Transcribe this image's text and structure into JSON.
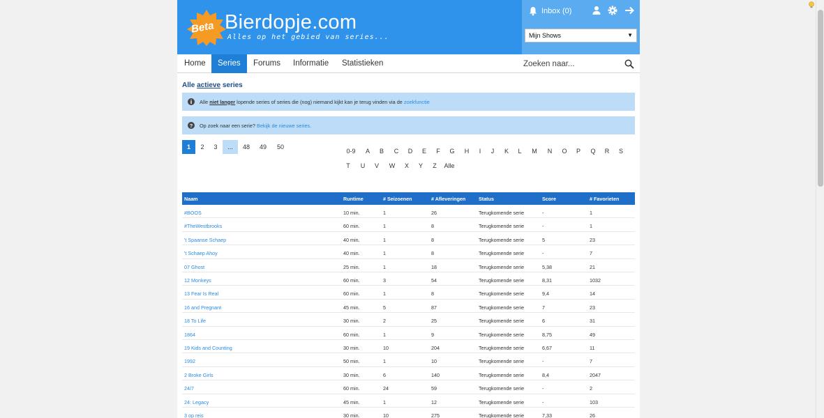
{
  "header": {
    "badge": "Beta",
    "logo_name": "Bierdopje.com",
    "tagline": "Alles op het gebied van series...",
    "inbox_label": "Inbox (0)",
    "shows_select": "Mijn Shows"
  },
  "nav": {
    "items": [
      "Home",
      "Series",
      "Forums",
      "Informatie",
      "Statistieken"
    ],
    "active": "Series",
    "search_placeholder": "Zoeken naar..."
  },
  "title": {
    "prefix": "Alle",
    "highlight": "actieve",
    "suffix": "series"
  },
  "alerts": {
    "first": {
      "t1": "Alle",
      "t2": "niet langer",
      "t3": "lopende series of series die (nog) niemand kijkt kan je terug vinden via de",
      "link": "zoekfunctie"
    },
    "second": {
      "t1": "Op zoek naar een serie?",
      "link": "Bekijk de nieuwe series."
    }
  },
  "pagination": [
    "1",
    "2",
    "3",
    "...",
    "48",
    "49",
    "50"
  ],
  "letters_row1": [
    "0-9",
    "A",
    "B",
    "C",
    "D",
    "E",
    "F",
    "G",
    "H",
    "I",
    "J",
    "K",
    "L",
    "M",
    "N",
    "O",
    "P",
    "Q",
    "R",
    "S"
  ],
  "letters_row2": [
    "T",
    "U",
    "V",
    "W",
    "X",
    "Y",
    "Z",
    "Alle"
  ],
  "table": {
    "columns": [
      "Naam",
      "Runtime",
      "# Seizoenen",
      "# Afleveringen",
      "Status",
      "Score",
      "# Favorieten"
    ],
    "rows": [
      [
        "#BOOS",
        "10 min.",
        "1",
        "26",
        "Terugkomende serie",
        "-",
        "1"
      ],
      [
        "#TheWestbrooks",
        "60 min.",
        "1",
        "8",
        "Terugkomende serie",
        "-",
        "1"
      ],
      [
        "'t Spaanse Schaep",
        "40 min.",
        "1",
        "8",
        "Terugkomende serie",
        "5",
        "23"
      ],
      [
        "'t Schaep Ahoy",
        "40 min.",
        "1",
        "8",
        "Terugkomende serie",
        "-",
        "7"
      ],
      [
        "07 Ghost",
        "25 min.",
        "1",
        "18",
        "Terugkomende serie",
        "5,38",
        "21"
      ],
      [
        "12 Monkeys",
        "60 min.",
        "3",
        "54",
        "Terugkomende serie",
        "8,31",
        "1032"
      ],
      [
        "13 Fear Is Real",
        "60 min.",
        "1",
        "8",
        "Terugkomende serie",
        "9,4",
        "14"
      ],
      [
        "16 and Pregnant",
        "45 min.",
        "5",
        "87",
        "Terugkomende serie",
        "7",
        "23"
      ],
      [
        "18 To Life",
        "30 min.",
        "2",
        "25",
        "Terugkomende serie",
        "6",
        "31"
      ],
      [
        "1864",
        "60 min.",
        "1",
        "9",
        "Terugkomende serie",
        "8,75",
        "49"
      ],
      [
        "19 Kids and Counting",
        "30 min.",
        "10",
        "204",
        "Terugkomende serie",
        "6,67",
        "11"
      ],
      [
        "1992",
        "50 min.",
        "1",
        "10",
        "Terugkomende serie",
        "-",
        "7"
      ],
      [
        "2 Broke Girls",
        "30 min.",
        "6",
        "140",
        "Terugkomende serie",
        "8,4",
        "2047"
      ],
      [
        "24/7",
        "60 min.",
        "24",
        "59",
        "Terugkomende serie",
        "-",
        "2"
      ],
      [
        "24: Legacy",
        "45 min.",
        "1",
        "12",
        "Terugkomende serie",
        "-",
        "103"
      ],
      [
        "3 op reis",
        "30 min.",
        "10",
        "275",
        "Terugkomende serie",
        "7,33",
        "26"
      ]
    ]
  },
  "colors": {
    "header_blue": "#2f93ec",
    "userbar_blue": "#5aabf0",
    "active_blue": "#1f7ed6",
    "table_head": "#1f6ec7",
    "alert_bg": "#bcdcf7",
    "link": "#2a8be0"
  }
}
